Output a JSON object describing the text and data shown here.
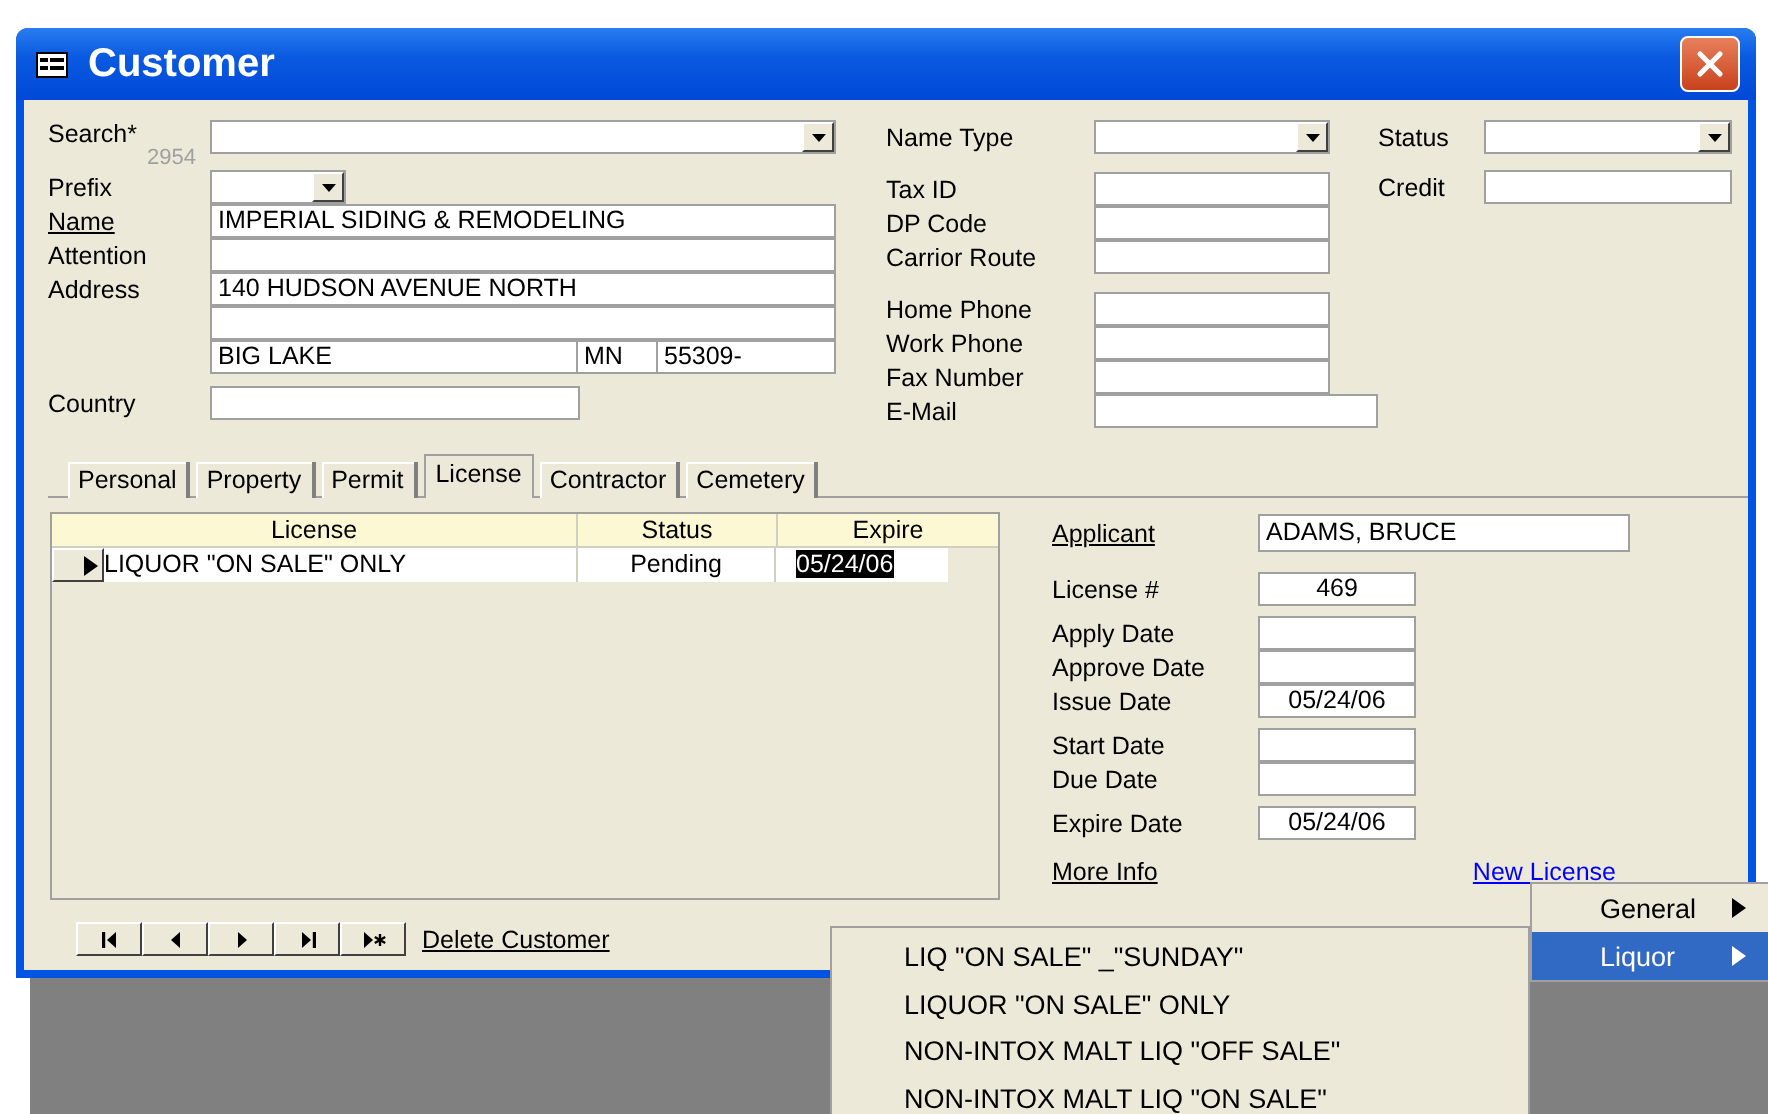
{
  "window": {
    "title": "Customer"
  },
  "customer": {
    "search": {
      "label": "Search*",
      "counter": "2954"
    },
    "prefix": {
      "label": "Prefix"
    },
    "name": {
      "label": "Name",
      "value": "IMPERIAL SIDING & REMODELING"
    },
    "attention": {
      "label": "Attention"
    },
    "address": {
      "label": "Address",
      "line_1": "140 HUDSON AVENUE NORTH",
      "city": "BIG LAKE",
      "state": "MN",
      "zip": "55309-"
    },
    "country": {
      "label": "Country"
    },
    "name_type": {
      "label": "Name Type"
    },
    "id_fields": [
      {
        "label": "Tax ID"
      },
      {
        "label": "DP Code"
      },
      {
        "label": "Carrior Route"
      }
    ],
    "phone_fields": [
      {
        "label": "Home Phone"
      },
      {
        "label": "Work Phone"
      },
      {
        "label": "Fax Number"
      }
    ],
    "email": {
      "label": "E-Mail"
    },
    "status": {
      "label": "Status"
    },
    "credit": {
      "label": "Credit"
    }
  },
  "tabs": [
    {
      "label": "Personal",
      "selected": false
    },
    {
      "label": "Property",
      "selected": false
    },
    {
      "label": "Permit",
      "selected": false
    },
    {
      "label": "License",
      "selected": true
    },
    {
      "label": "Contractor",
      "selected": false
    },
    {
      "label": "Cemetery",
      "selected": false
    }
  ],
  "license_table": {
    "columns": [
      "License",
      "Status",
      "Expire"
    ],
    "rows": [
      {
        "license": "LIQUOR \"ON SALE\" ONLY",
        "status": "Pending",
        "expire": "05/24/06",
        "current": true,
        "expire_highlighted": true
      }
    ]
  },
  "license_details": {
    "applicant": {
      "label": "Applicant",
      "value": "ADAMS, BRUCE"
    },
    "field_groups": [
      [
        {
          "label": "License #",
          "value": "469"
        }
      ],
      [
        {
          "label": "Apply Date"
        },
        {
          "label": "Approve Date"
        },
        {
          "label": "Issue Date",
          "value": "05/24/06"
        }
      ],
      [
        {
          "label": "Start Date"
        },
        {
          "label": "Due Date"
        }
      ],
      [
        {
          "label": "Expire Date",
          "value": "05/24/06"
        }
      ]
    ],
    "more_info": "More Info",
    "new_license": "New License"
  },
  "record_navigation": {
    "buttons": [
      {
        "kind": "first"
      },
      {
        "kind": "previous"
      },
      {
        "kind": "next"
      },
      {
        "kind": "last"
      },
      {
        "kind": "new"
      }
    ],
    "delete_link": "Delete Customer"
  },
  "context_menu": {
    "items": [
      {
        "label": "General",
        "selected": false,
        "has_submenu": true
      },
      {
        "label": "Liquor",
        "selected": true,
        "has_submenu": true
      }
    ]
  },
  "submenu": {
    "items": [
      "LIQ \"ON SALE\" _\"SUNDAY\"",
      "LIQUOR \"ON SALE\" ONLY",
      "NON-INTOX MALT LIQ \"OFF SALE\"",
      "NON-INTOX MALT LIQ \"ON SALE\""
    ]
  }
}
